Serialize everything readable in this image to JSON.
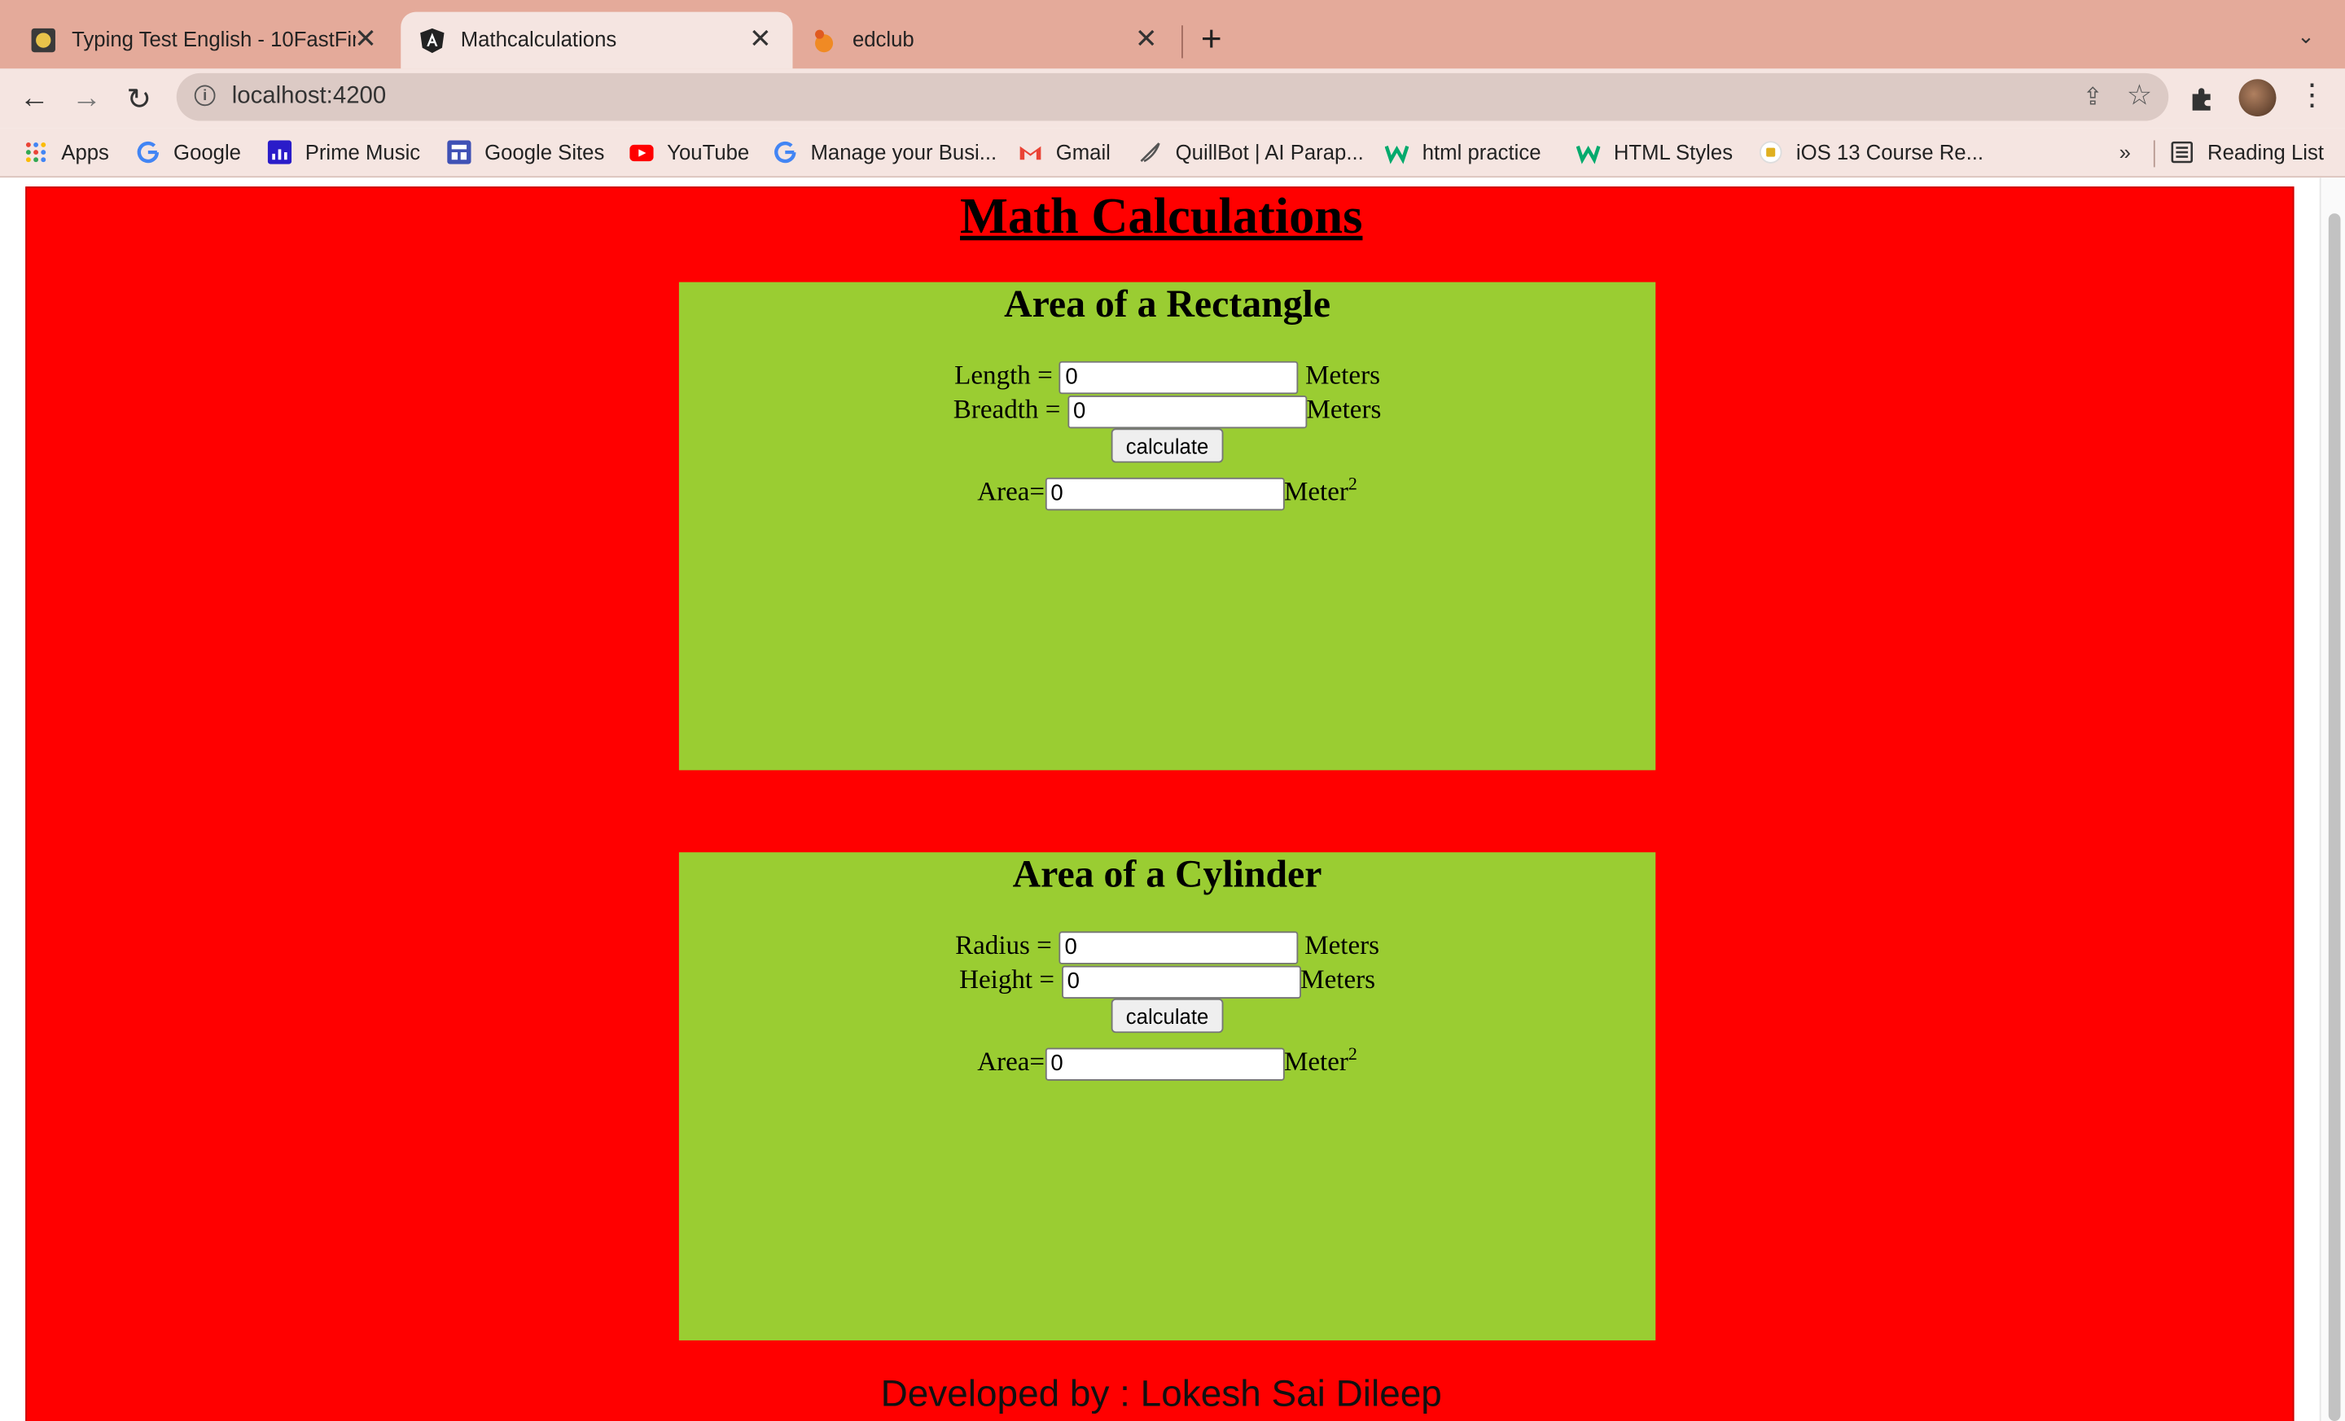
{
  "browser": {
    "tabs": [
      {
        "title": "Typing Test English - 10FastFingers",
        "active": false
      },
      {
        "title": "Mathcalculations",
        "active": true
      },
      {
        "title": "edclub",
        "active": false
      }
    ],
    "tab_close_glyph": "✕",
    "new_tab_glyph": "+",
    "tab_menu_glyph": "⌄",
    "nav": {
      "back": "←",
      "forward": "→",
      "reload": "↻"
    },
    "url": "localhost:4200",
    "info_glyph": "i",
    "share_glyph": "⇪",
    "star_glyph": "☆",
    "menu_glyph": "⋮",
    "bookmarks": [
      {
        "label": "Apps",
        "icon": "apps-grid-icon"
      },
      {
        "label": "Google",
        "icon": "google-icon"
      },
      {
        "label": "Prime Music",
        "icon": "prime-music-icon"
      },
      {
        "label": "Google Sites",
        "icon": "google-sites-icon"
      },
      {
        "label": "YouTube",
        "icon": "youtube-icon"
      },
      {
        "label": "Manage your Busi...",
        "icon": "google-icon"
      },
      {
        "label": "Gmail",
        "icon": "gmail-icon"
      },
      {
        "label": "QuillBot | AI Parap...",
        "icon": "quillbot-icon"
      },
      {
        "label": "html practice",
        "icon": "w3schools-icon"
      },
      {
        "label": "HTML Styles",
        "icon": "w3schools-icon"
      },
      {
        "label": "iOS 13 Course Re...",
        "icon": "course-icon"
      }
    ],
    "bookmarks_more": "»",
    "reading_list": "Reading List"
  },
  "page": {
    "title": "Math Calculations",
    "rectangle": {
      "title": "Area of a Rectangle",
      "length_label": "Length =",
      "length_value": "0",
      "length_unit": "Meters",
      "breadth_label": "Breadth =",
      "breadth_value": "0",
      "breadth_unit": "Meters",
      "button": "calculate",
      "area_label": "Area=",
      "area_value": "0",
      "area_unit": "Meter",
      "area_exp": "2"
    },
    "cylinder": {
      "title": "Area of a Cylinder",
      "radius_label": "Radius =",
      "radius_value": "0",
      "radius_unit": "Meters",
      "height_label": "Height =",
      "height_value": "0",
      "height_unit": "Meters",
      "button": "calculate",
      "area_label": "Area=",
      "area_value": "0",
      "area_unit": "Meter",
      "area_exp": "2"
    },
    "footer": "Developed by : Lokesh Sai Dileep"
  },
  "colors": {
    "page_bg": "#ff0000",
    "card_bg": "#9acd32",
    "tab_strip": "#e4aa9a",
    "toolbar": "#f5e5e1"
  }
}
